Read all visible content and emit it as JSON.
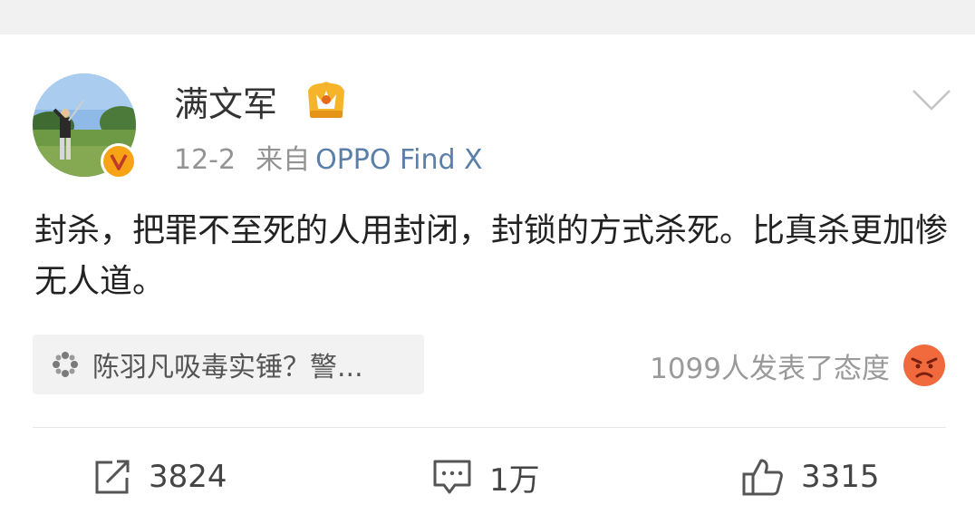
{
  "post": {
    "author": {
      "name": "满文军",
      "verified_badge": "V",
      "avatar_icon": "golfer-avatar",
      "member_icon": "crown-icon"
    },
    "meta": {
      "date": "12-2",
      "from_label": "来自",
      "source": "OPPO Find X"
    },
    "menu_icon": "chevron-down-icon",
    "text": "封杀，把罪不至死的人用封闭，封锁的方式杀死。比真杀更加惨无人道。",
    "topic": {
      "icon": "flower-icon",
      "label": "陈羽凡吸毒实锤？警..."
    },
    "reactions": {
      "label": "1099人发表了态度",
      "icon": "angry-face-icon"
    },
    "actions": {
      "repost": {
        "icon": "repost-icon",
        "count": "3824"
      },
      "comment": {
        "icon": "comment-icon",
        "count": "1万"
      },
      "like": {
        "icon": "thumbs-up-icon",
        "count": "3315"
      }
    }
  },
  "colors": {
    "link_blue": "#5b7fa8",
    "badge_orange": "#f6a416",
    "muted_text": "#939393",
    "top_strip": "#f1f1f1"
  }
}
